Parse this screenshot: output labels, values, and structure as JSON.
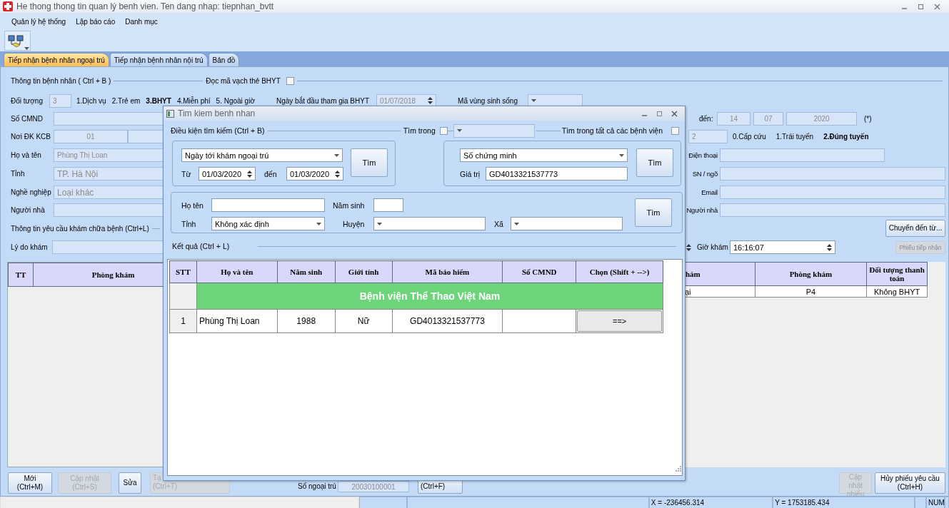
{
  "window": {
    "title": "He thong thong tin quan lý benh vien. Ten dang nhap: tiepnhan_bvtt"
  },
  "menu": [
    "Quản lý hệ thống",
    "Lập báo cáo",
    "Danh mục"
  ],
  "tabs": [
    {
      "label": "Tiếp nhận bệnh nhân ngoại trú",
      "selected": true
    },
    {
      "label": "Tiếp nhận bệnh nhân nội trú",
      "selected": false
    },
    {
      "label": "Bản đồ",
      "selected": false
    }
  ],
  "patient_section": {
    "title": "Thông tin bệnh nhân ( Ctrl + B )",
    "barcode_label": "Đọc mã vạch thẻ BHYT",
    "barcode_checked": false
  },
  "patient_type": {
    "label": "Đối tượng",
    "value": "3",
    "options": [
      {
        "label": "1.Dịch vụ",
        "selected": false
      },
      {
        "label": "2.Trẻ em",
        "selected": false
      },
      {
        "label": "3.BHYT",
        "selected": true
      },
      {
        "label": "4.Miễn phí",
        "selected": false
      },
      {
        "label": "5. Ngoài giờ",
        "selected": false
      }
    ]
  },
  "bhyt_start": {
    "label": "Ngày bắt đầu tham gia BHYT",
    "value": "01/07/2018"
  },
  "region_code": {
    "label": "Mã vùng sinh sống"
  },
  "left_fields": [
    {
      "label": "Số CMND",
      "kind": "text"
    },
    {
      "label": "Nơi ĐK KCB",
      "kind": "split",
      "value": "01"
    },
    {
      "label": "Họ và tên",
      "kind": "text",
      "value": "Phùng Thị Loan"
    },
    {
      "label": "Tỉnh",
      "kind": "combo",
      "value": "TP. Hà Nội"
    },
    {
      "label": "Nghề nghiệp",
      "kind": "combo",
      "value": "Loại khác"
    },
    {
      "label": "Người nhà",
      "kind": "text"
    }
  ],
  "card_end": {
    "label": "đến:",
    "values": [
      "14",
      "07",
      "2020"
    ],
    "required_mark": "(*)"
  },
  "route": {
    "value": "2",
    "options": [
      {
        "label": "0.Cấp cứu",
        "selected": false
      },
      {
        "label": "1.Trái tuyến",
        "selected": false
      },
      {
        "label": "2.Đúng tuyến",
        "selected": true
      }
    ]
  },
  "right_fields": [
    {
      "label": "Điện thoại",
      "kind": "short"
    },
    {
      "label": "SN / ngõ",
      "kind": "text"
    },
    {
      "label": "Email",
      "kind": "text"
    },
    {
      "label": "Người nhà",
      "kind": "text"
    }
  ],
  "request_section": {
    "title": "Thông tin yêu cầu khám chữa bệnh (Ctrl+L)",
    "transfer_button": "Chuyển đến từ..."
  },
  "reason": {
    "label": "Lý do khám"
  },
  "exam_time": {
    "label": "Giờ khám",
    "value": "16:16:07"
  },
  "receipt_button": {
    "label": "Phiếu tiếp nhận",
    "disabled": true
  },
  "left_table": {
    "columns": [
      "TT",
      "Phòng khám"
    ]
  },
  "right_table": {
    "columns": [
      "hám",
      "Phòng khám",
      "Đối tượng thanh toán"
    ],
    "rows": [
      [
        "ại",
        "P4",
        "Không BHYT"
      ]
    ]
  },
  "bottom_left_buttons": [
    {
      "lines": [
        "Mới",
        "(Ctrl+M)"
      ],
      "disabled": false,
      "kind": "full"
    },
    {
      "lines": [
        "Cập nhật",
        "(Ctrl+S)"
      ],
      "disabled": true,
      "kind": "full"
    },
    {
      "lines": [
        "Sửa"
      ],
      "disabled": false,
      "kind": "full"
    },
    {
      "lines": [
        "Tạ",
        "(Ctrl+T)"
      ],
      "disabled": true,
      "kind": "partial"
    }
  ],
  "outpatient_no": {
    "label": "Số ngoại trú",
    "value": "20030100001"
  },
  "find_button": {
    "lines": [
      "(Ctrl+F)"
    ],
    "disabled": false,
    "kind": "partial"
  },
  "bottom_right_buttons": [
    {
      "lines": [
        "Cập nhật",
        "phiếu"
      ],
      "disabled": true
    },
    {
      "lines": [
        "Hủy phiếu yêu cầu",
        "(Ctrl+H)"
      ],
      "disabled": false
    }
  ],
  "status_bar": [
    "X = -236456.314",
    "Y = 1753185.434",
    "NUM"
  ],
  "search_dialog": {
    "title": "Tim kiem benh nhan",
    "criteria_title": "Điều kiện tìm kiếm (Ctrl + B)",
    "search_in": {
      "label": "Tìm trong",
      "checked": false
    },
    "search_all": {
      "label": "Tìm trong tất cả các bệnh viện",
      "checked": false
    },
    "date_group": {
      "criterion": "Ngày tới khám ngoại trú",
      "from_label": "Từ",
      "from": "01/03/2020",
      "to_label": "đến",
      "to": "01/03/2020",
      "button": "Tìm"
    },
    "id_group": {
      "criterion": "Số chứng minh",
      "value_label": "Giá trị",
      "value": "GD4013321537773",
      "button": "Tìm"
    },
    "name_group": {
      "name_label": "Họ tên",
      "year_label": "Năm sinh",
      "province_label": "Tỉnh",
      "province": "Không xác định",
      "district_label": "Huyện",
      "commune_label": "Xã",
      "button": "Tìm"
    },
    "results_title": "Kết quả (Ctrl + L)",
    "table": {
      "columns": [
        "STT",
        "Họ và tên",
        "Năm sinh",
        "Giới tính",
        "Mã bảo hiểm",
        "Số CMND",
        "Chọn (Shift + -->)"
      ],
      "groups": [
        {
          "title": "Bệnh viện Thể Thao Việt Nam",
          "rows": [
            {
              "cells": [
                "1",
                "Phùng Thị Loan",
                "1988",
                "Nữ",
                "GD4013321537773",
                null
              ],
              "action": "==>"
            }
          ]
        }
      ]
    }
  }
}
